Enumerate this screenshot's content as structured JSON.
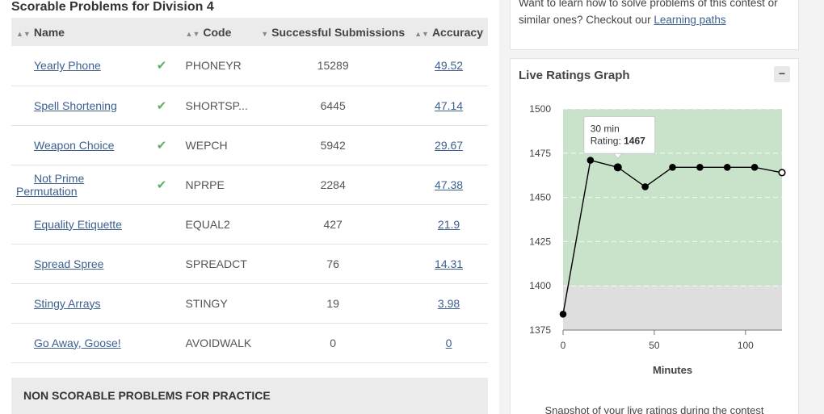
{
  "title": "Scorable Problems for Division 4",
  "columns": {
    "name": "Name",
    "code": "Code",
    "submissions": "Successful Submissions",
    "accuracy": "Accuracy"
  },
  "problems": [
    {
      "name": "Yearly Phone",
      "solved": true,
      "code": "PHONEYR",
      "submissions": "15289",
      "accuracy": "49.52"
    },
    {
      "name": "Spell Shortening",
      "solved": true,
      "code": "SHORTSP...",
      "submissions": "6445",
      "accuracy": "47.14"
    },
    {
      "name": "Weapon Choice",
      "solved": true,
      "code": "WEPCH",
      "submissions": "5942",
      "accuracy": "29.67"
    },
    {
      "name": "Not Prime Permutation",
      "solved": true,
      "code": "NPRPE",
      "submissions": "2284",
      "accuracy": "47.38"
    },
    {
      "name": "Equality Etiquette",
      "solved": false,
      "code": "EQUAL2",
      "submissions": "427",
      "accuracy": "21.9"
    },
    {
      "name": "Spread Spree",
      "solved": false,
      "code": "SPREADCT",
      "submissions": "76",
      "accuracy": "14.31"
    },
    {
      "name": "Stingy Arrays",
      "solved": false,
      "code": "STINGY",
      "submissions": "19",
      "accuracy": "3.98"
    },
    {
      "name": "Go Away, Goose!",
      "solved": false,
      "code": "AVOIDWALK",
      "submissions": "0",
      "accuracy": "0"
    }
  ],
  "non_scorable_title": "NON SCORABLE PROBLEMS FOR PRACTICE",
  "info": {
    "line1": "Want to learn how to solve problems of this contest or",
    "line2_prefix": "similar ones? Checkout our ",
    "link": "Learning paths"
  },
  "graph": {
    "title": "Live Ratings Graph",
    "collapse_symbol": "−",
    "caption": "Snapshot of your live ratings during the contest",
    "tooltip": {
      "time": "30 min",
      "label": "Rating: ",
      "value": "1467"
    }
  },
  "chart_data": {
    "type": "line",
    "title": "Live Ratings Graph",
    "xlabel": "Minutes",
    "ylabel": "",
    "xlim": [
      0,
      120
    ],
    "ylim": [
      1375,
      1500
    ],
    "xticks": [
      0,
      50,
      100
    ],
    "yticks": [
      1375,
      1400,
      1425,
      1450,
      1475,
      1500
    ],
    "grid": true,
    "x": [
      0,
      15,
      30,
      45,
      60,
      75,
      90,
      105,
      120
    ],
    "y": [
      1384,
      1471,
      1467,
      1456,
      1467,
      1467,
      1467,
      1467,
      1464
    ],
    "bands": [
      {
        "from": 1400,
        "to": 1500,
        "color": "#c9e3cb"
      },
      {
        "from": 1375,
        "to": 1400,
        "color": "#dedede"
      }
    ],
    "line_color": "#000000"
  },
  "colors": {
    "link": "#3d5f8f",
    "check": "#5fb065",
    "header_bg": "#ebebeb"
  }
}
